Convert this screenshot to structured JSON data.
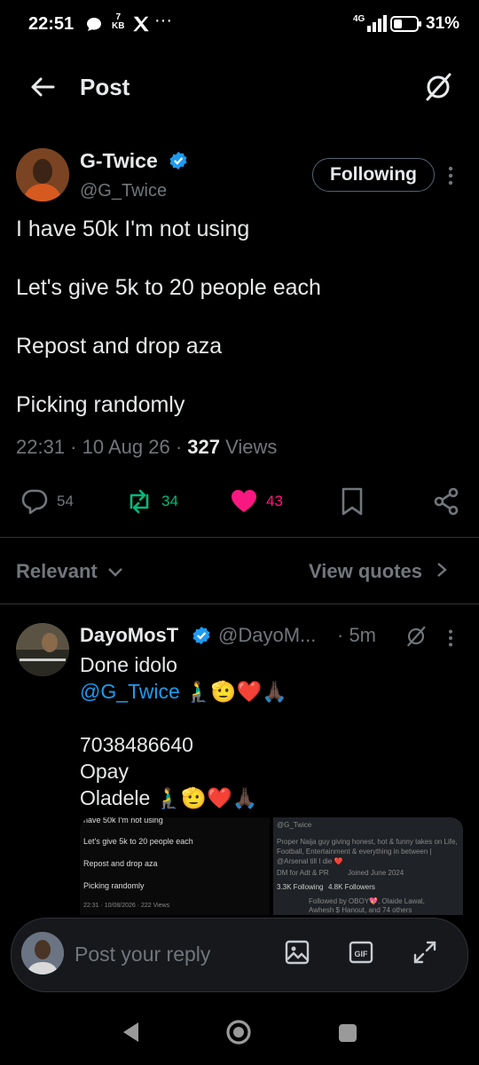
{
  "status_bar": {
    "time": "22:51",
    "speed_value": "7",
    "speed_unit": "KB",
    "more": "···",
    "network": "4G",
    "battery": "31%"
  },
  "header": {
    "title": "Post"
  },
  "post": {
    "author_name": "G-Twice",
    "handle": "@G_Twice",
    "follow_label": "Following",
    "lines": [
      "I have 50k I'm not using",
      "Let's give 5k to 20 people each",
      "Repost and drop aza",
      "Picking randomly"
    ],
    "time": "22:31",
    "date": "10 Aug 26",
    "views_count": "327",
    "views_label": "Views",
    "replies": "54",
    "reposts": "34",
    "likes": "43"
  },
  "filter": {
    "label": "Relevant",
    "quotes_label": "View quotes"
  },
  "reply": {
    "author_name": "DayoMosT",
    "handle": "@DayoM...",
    "time": "· 5m",
    "line1": "Done idolo",
    "mention": "@G_Twice",
    "emojis": "🧎‍♂️🫡❤️🙏🏿",
    "number": "7038486640",
    "bank": "Opay",
    "name_line": "Oladele",
    "embed_left": {
      "line0": "have 50k I'm not using",
      "line1": "Let's give 5k to 20 people each",
      "line2": "Repost and drop aza",
      "line3": "Picking randomly",
      "meta": "22:31 · 10/08/2026 · 222 Views"
    },
    "embed_right": {
      "handle": "@G_Twice",
      "bio": "Proper Naija guy giving honest, hot & funny takes on Life, Football, Entertainment & everything in between | @Arsenal till I die ❤️",
      "dm": "DM for Adt & PR",
      "joined": "Joined June 2024",
      "following": "3.3K Following",
      "followers": "4.8K Followers",
      "followed_by": "Followed by OBOY💖, Olaide Lawal,",
      "followed_by2": "Awhesh $ Hanout, and 74 others"
    }
  },
  "composer": {
    "placeholder": "Post your reply"
  },
  "colors": {
    "accent": "#1d9bf0",
    "repost": "#00ba7c",
    "like": "#f91880",
    "muted": "#71767b"
  }
}
